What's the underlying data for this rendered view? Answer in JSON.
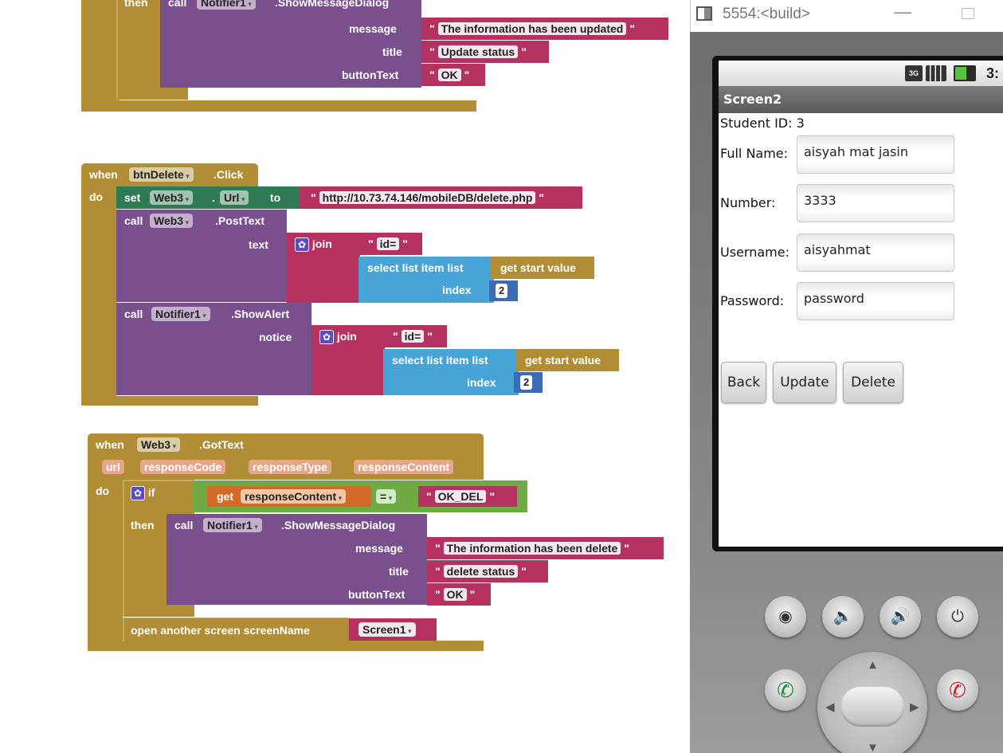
{
  "blocks": {
    "group1": {
      "then": "then",
      "call": "call",
      "component": "Notifier1",
      "method": ".ShowMessageDialog",
      "params": [
        "message",
        "title",
        "buttonText"
      ],
      "values": [
        "The information has been updated",
        "Update status",
        "OK"
      ]
    },
    "group2": {
      "when": "when",
      "component": "btnDelete",
      "event": ".Click",
      "do": "do",
      "set": "set",
      "set_component": "Web3",
      "dot": ".",
      "property": "Url",
      "to": "to",
      "url_value": "http://10.73.74.146/mobileDB/delete.php",
      "call1": "call",
      "call1_component": "Web3",
      "call1_method": ".PostText",
      "text_param": "text",
      "join1": "join",
      "join1_string": "id=",
      "select1": "select list item  list",
      "get1": "get start value",
      "index1": "index",
      "index1_value": "2",
      "call2": "call",
      "call2_component": "Notifier1",
      "call2_method": ".ShowAlert",
      "notice_param": "notice",
      "join2": "join",
      "join2_string": "id=",
      "select2": "select list item  list",
      "get2": "get start value",
      "index2": "index",
      "index2_value": "2"
    },
    "group3": {
      "when": "when",
      "component": "Web3",
      "event": ".GotText",
      "event_params": [
        "url",
        "responseCode",
        "responseType",
        "responseContent"
      ],
      "do": "do",
      "if": "if",
      "get": "get",
      "get_var": "responseContent",
      "op": "=",
      "compare_value": "OK_DEL",
      "then": "then",
      "call": "call",
      "call_component": "Notifier1",
      "call_method": ".ShowMessageDialog",
      "params": [
        "message",
        "title",
        "buttonText"
      ],
      "values": [
        "The information has been delete",
        "delete status",
        "OK"
      ],
      "open_screen": "open another screen  screenName",
      "screen_value": "Screen1"
    }
  },
  "emulator": {
    "title": "5554:<build>",
    "minimize": "—",
    "status": {
      "network": "3G",
      "time": "3:"
    },
    "app_title": "Screen2",
    "student_id": "Student ID: 3",
    "fields": [
      {
        "label": "Full Name:",
        "value": "aisyah mat jasin"
      },
      {
        "label": "Number:",
        "value": "3333"
      },
      {
        "label": "Username:",
        "value": "aisyahmat"
      },
      {
        "label": "Password:",
        "value": "password"
      }
    ],
    "buttons": [
      "Back",
      "Update",
      "Delete"
    ]
  }
}
